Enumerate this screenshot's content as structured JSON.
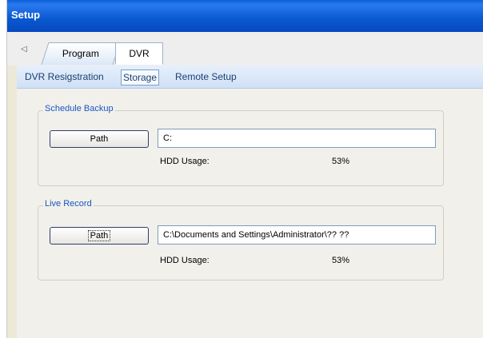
{
  "window": {
    "title": "Setup"
  },
  "tabs": [
    {
      "label": "Program",
      "active": false
    },
    {
      "label": "DVR",
      "active": true
    }
  ],
  "subtabs": [
    {
      "label": "DVR Resigstration",
      "active": false
    },
    {
      "label": "Storage",
      "active": true
    },
    {
      "label": "Remote Setup",
      "active": false
    }
  ],
  "schedule_backup": {
    "legend": "Schedule Backup",
    "path_button": "Path",
    "path_value": "C:",
    "hdd_label": "HDD Usage:",
    "hdd_value": "53%"
  },
  "live_record": {
    "legend": "Live Record",
    "path_button": "Path",
    "path_value": "C:\\Documents and Settings\\Administrator\\?? ??",
    "hdd_label": "HDD Usage:",
    "hdd_value": "53%"
  },
  "colors": {
    "titlebar": "#0a58d0",
    "legend_text": "#1a56c2",
    "subtab_text": "#1c3f70"
  },
  "icons": {
    "tab_scroll": "triangle-left-icon"
  }
}
